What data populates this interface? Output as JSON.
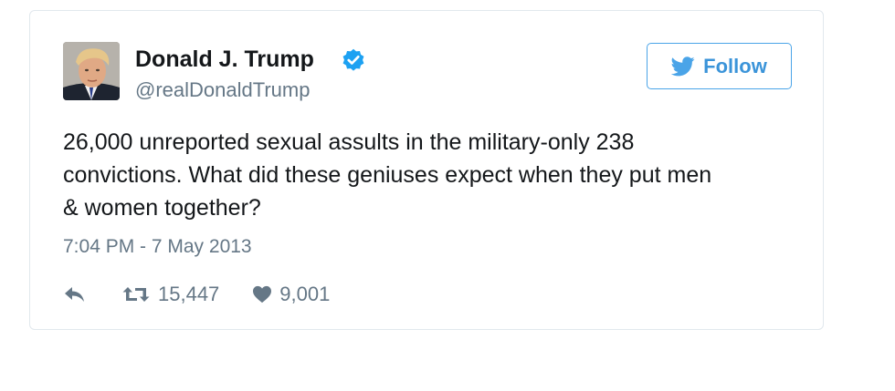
{
  "user": {
    "display_name": "Donald J. Trump",
    "handle": "@realDonaldTrump",
    "verified": true,
    "avatar_icon": "profile-photo"
  },
  "follow_button": {
    "label": "Follow",
    "icon": "twitter-bird-icon",
    "color": "#3b94d9"
  },
  "tweet": {
    "text_lines": [
      "26,000 unreported sexual assults in the military-only 238",
      "convictions. What did these geniuses expect when they put men",
      "& women together?"
    ],
    "timestamp": "7:04 PM - 7 May 2013"
  },
  "actions": {
    "reply_icon": "reply-icon",
    "retweet_icon": "retweet-icon",
    "retweet_count": "15,447",
    "like_icon": "heart-icon",
    "like_count": "9,001"
  },
  "colors": {
    "primary_text": "#14171a",
    "secondary_text": "#657786",
    "verified_blue": "#1da1f2",
    "border": "#e1e8ed"
  }
}
